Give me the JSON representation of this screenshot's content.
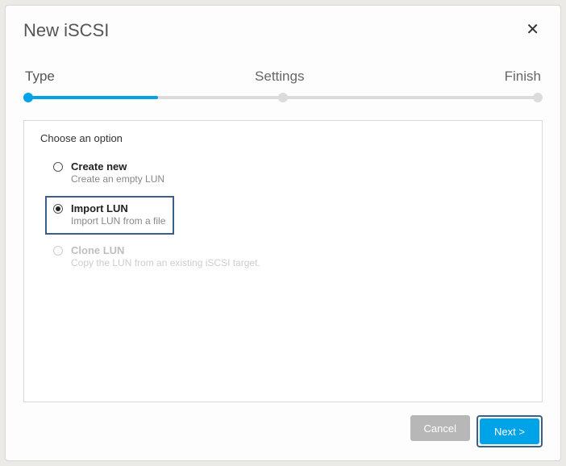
{
  "header": {
    "title": "New iSCSI",
    "close_symbol": "✕"
  },
  "steps": {
    "s1": "Type",
    "s2": "Settings",
    "s3": "Finish"
  },
  "panel": {
    "title": "Choose an option",
    "options": {
      "create": {
        "label": "Create new",
        "desc": "Create an empty LUN"
      },
      "import": {
        "label": "Import LUN",
        "desc": "Import LUN from a file"
      },
      "clone": {
        "label": "Clone LUN",
        "desc": "Copy the LUN from an existing iSCSI target."
      }
    }
  },
  "footer": {
    "cancel": "Cancel",
    "next": "Next >"
  }
}
